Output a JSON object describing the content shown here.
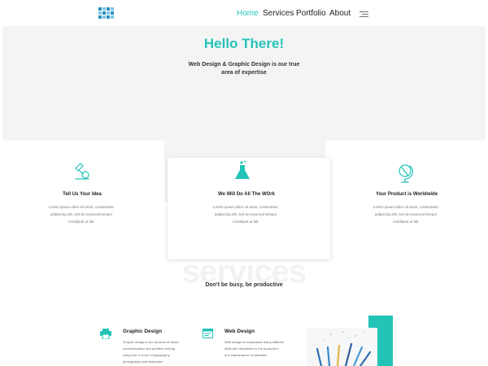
{
  "nav": {
    "items": [
      "Home",
      "Services",
      "Portfolio",
      "About"
    ],
    "active": "Home",
    "menu_icon": "hamburger-icon"
  },
  "hero": {
    "title": "Hello There!",
    "subtitle_line1": "Web Design & Graphic Design is our true",
    "subtitle_line2": "area of  expertise"
  },
  "features": [
    {
      "icon": "lamp-icon",
      "title": "Tell Us Your Idea",
      "lines": [
        "Lorem ipsum dolor sit amet, consectetur",
        "adipiscing elit, sed do eiusmod tempor",
        "incididunt ut lab"
      ]
    },
    {
      "icon": "flask-icon",
      "title": "We Will Do All The WOrk",
      "lines": [
        "Lorem ipsum dolor sit amet, consectetur",
        "adipiscing elit, sed do eiusmod tempor",
        "incididunt ut lab"
      ]
    },
    {
      "icon": "globe-icon",
      "title": "Your Product is Worldwide",
      "lines": [
        "Lorem ipsum dolor sit amet, consectetur",
        "adipiscing elit, sed do eiusmod tempor",
        "incididunt ut lab"
      ]
    }
  ],
  "services_section": {
    "watermark": "services",
    "tagline": "Don't be busy, be productive"
  },
  "services": [
    {
      "icon": "printer-icon",
      "title": "Graphic Design",
      "lines": [
        "Graphic design is the process of visual",
        "communication and problem-solving",
        "using one or more of typography,",
        "photography and illustration"
      ]
    },
    {
      "icon": "browser-icon",
      "title": "Web Design",
      "lines": [
        "Web design encompasses many different",
        "skills and disciplines in the production",
        "and maintenance of websites."
      ]
    }
  ],
  "colors": {
    "accent": "#23c3b8",
    "logo": "#2a8fc0"
  }
}
